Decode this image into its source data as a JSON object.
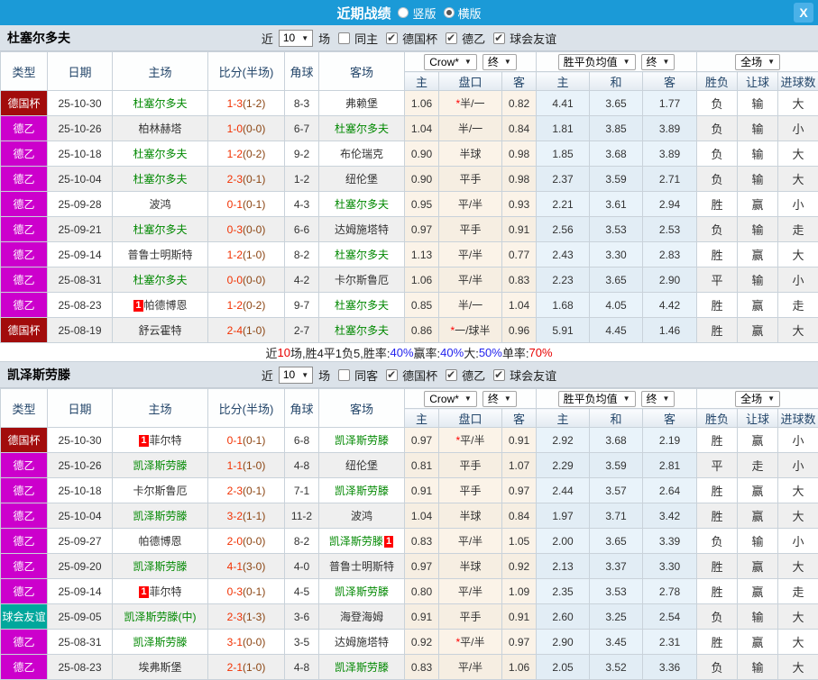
{
  "titlebar": {
    "title": "近期战绩",
    "radio_vertical": "竖版",
    "radio_horizontal": "横版",
    "close": "X"
  },
  "colors": {
    "titlebar_blue": "#1b9ad7",
    "cup_red": "#a20c0c",
    "league_magenta": "#cc00cc",
    "friendly_teal": "#00a79c",
    "focus_team_green": "#008800",
    "win_red": "#dd0000",
    "lose_green": "#008800",
    "draw_blue": "#1515dd"
  },
  "columns": {
    "type": "类型",
    "date": "日期",
    "home": "主场",
    "score": "比分(半场)",
    "corner": "角球",
    "away": "客场",
    "odds_home": "主",
    "handicap": "盘口",
    "odds_away": "客",
    "avg_home": "主",
    "avg_draw": "和",
    "avg_away": "客",
    "result": "胜负",
    "let_goal": "让球",
    "goals": "进球数"
  },
  "dropdowns": {
    "bookmaker": "Crow*",
    "final": "终",
    "avg": "胜平负均值",
    "fulltime": "全场"
  },
  "sections": [
    {
      "team": "杜塞尔多夫",
      "filter": {
        "near": "近",
        "count": "10",
        "games": "场",
        "same": "同主",
        "leagues": [
          "德国杯",
          "德乙",
          "球会友谊"
        ]
      },
      "rows": [
        {
          "type": "德国杯",
          "tc": "cup",
          "date": "25-10-30",
          "home": "杜塞尔多夫",
          "hg": 1,
          "score": "1-3",
          "half": "(1-2)",
          "corner": "8-3",
          "away": "弗赖堡",
          "o1": "1.06",
          "star": 1,
          "hcap": "半/一",
          "o2": "0.82",
          "a1": "4.41",
          "a2": "3.65",
          "a3": "1.77",
          "r1": "负",
          "c1": "g",
          "r2": "输",
          "c2": "g",
          "r3": "大",
          "c3": "r"
        },
        {
          "type": "德乙",
          "tc": "lg",
          "date": "25-10-26",
          "home": "柏林赫塔",
          "score": "1-0",
          "half": "(0-0)",
          "corner": "6-7",
          "away": "杜塞尔多夫",
          "ag": 1,
          "o1": "1.04",
          "hcap": "半/一",
          "o2": "0.84",
          "a1": "1.81",
          "a2": "3.85",
          "a3": "3.89",
          "r1": "负",
          "c1": "g",
          "r2": "输",
          "c2": "g",
          "r3": "小",
          "c3": "g"
        },
        {
          "type": "德乙",
          "tc": "lg",
          "date": "25-10-18",
          "home": "杜塞尔多夫",
          "hg": 1,
          "score": "1-2",
          "half": "(0-2)",
          "corner": "9-2",
          "away": "布伦瑞克",
          "o1": "0.90",
          "hcap": "半球",
          "o2": "0.98",
          "a1": "1.85",
          "a2": "3.68",
          "a3": "3.89",
          "r1": "负",
          "c1": "g",
          "r2": "输",
          "c2": "g",
          "r3": "大",
          "c3": "r"
        },
        {
          "type": "德乙",
          "tc": "lg",
          "date": "25-10-04",
          "home": "杜塞尔多夫",
          "hg": 1,
          "score": "2-3",
          "half": "(0-1)",
          "corner": "1-2",
          "away": "纽伦堡",
          "o1": "0.90",
          "hcap": "平手",
          "o2": "0.98",
          "a1": "2.37",
          "a2": "3.59",
          "a3": "2.71",
          "r1": "负",
          "c1": "g",
          "r2": "输",
          "c2": "g",
          "r3": "大",
          "c3": "r"
        },
        {
          "type": "德乙",
          "tc": "lg",
          "date": "25-09-28",
          "home": "波鸿",
          "score": "0-1",
          "half": "(0-1)",
          "corner": "4-3",
          "away": "杜塞尔多夫",
          "ag": 1,
          "o1": "0.95",
          "hcap": "平/半",
          "o2": "0.93",
          "a1": "2.21",
          "a2": "3.61",
          "a3": "2.94",
          "r1": "胜",
          "c1": "r",
          "r2": "赢",
          "c2": "r",
          "r3": "小",
          "c3": "g"
        },
        {
          "type": "德乙",
          "tc": "lg",
          "date": "25-09-21",
          "home": "杜塞尔多夫",
          "hg": 1,
          "score": "0-3",
          "half": "(0-0)",
          "corner": "6-6",
          "away": "达姆施塔特",
          "o1": "0.97",
          "hcap": "平手",
          "o2": "0.91",
          "a1": "2.56",
          "a2": "3.53",
          "a3": "2.53",
          "r1": "负",
          "c1": "g",
          "r2": "输",
          "c2": "g",
          "r3": "走",
          "c3": "b"
        },
        {
          "type": "德乙",
          "tc": "lg",
          "date": "25-09-14",
          "home": "普鲁士明斯特",
          "score": "1-2",
          "half": "(1-0)",
          "corner": "8-2",
          "away": "杜塞尔多夫",
          "ag": 1,
          "o1": "1.13",
          "hcap": "平/半",
          "o2": "0.77",
          "a1": "2.43",
          "a2": "3.30",
          "a3": "2.83",
          "r1": "胜",
          "c1": "r",
          "r2": "赢",
          "c2": "r",
          "r3": "大",
          "c3": "r"
        },
        {
          "type": "德乙",
          "tc": "lg",
          "date": "25-08-31",
          "home": "杜塞尔多夫",
          "hg": 1,
          "score": "0-0",
          "half": "(0-0)",
          "corner": "4-2",
          "away": "卡尔斯鲁厄",
          "o1": "1.06",
          "hcap": "平/半",
          "o2": "0.83",
          "a1": "2.23",
          "a2": "3.65",
          "a3": "2.90",
          "r1": "平",
          "c1": "b",
          "r2": "输",
          "c2": "g",
          "r3": "小",
          "c3": "g"
        },
        {
          "type": "德乙",
          "tc": "lg",
          "date": "25-08-23",
          "home": "帕德博恩",
          "hbadge": "1",
          "hbp": "before",
          "score": "1-2",
          "half": "(0-2)",
          "corner": "9-7",
          "away": "杜塞尔多夫",
          "ag": 1,
          "o1": "0.85",
          "hcap": "半/一",
          "o2": "1.04",
          "a1": "1.68",
          "a2": "4.05",
          "a3": "4.42",
          "r1": "胜",
          "c1": "r",
          "r2": "赢",
          "c2": "r",
          "r3": "走",
          "c3": "b"
        },
        {
          "type": "德国杯",
          "tc": "cup",
          "date": "25-08-19",
          "home": "舒云霍特",
          "score": "2-4",
          "half": "(1-0)",
          "corner": "2-7",
          "away": "杜塞尔多夫",
          "ag": 1,
          "o1": "0.86",
          "star": 1,
          "hcap": "一/球半",
          "o2": "0.96",
          "a1": "5.91",
          "a2": "4.45",
          "a3": "1.46",
          "r1": "胜",
          "c1": "r",
          "r2": "赢",
          "c2": "r",
          "r3": "大",
          "c3": "r"
        }
      ],
      "summary": [
        {
          "t": "近",
          "c": "k"
        },
        {
          "t": "10",
          "c": "r"
        },
        {
          "t": "场,胜4平1负5, ",
          "c": "k"
        },
        {
          "t": "胜率:",
          "c": "k"
        },
        {
          "t": "40%",
          "c": "b"
        },
        {
          "t": " 赢率:",
          "c": "k"
        },
        {
          "t": "40%",
          "c": "b"
        },
        {
          "t": " 大:",
          "c": "k"
        },
        {
          "t": "50%",
          "c": "b"
        },
        {
          "t": " 单率:",
          "c": "k"
        },
        {
          "t": "70%",
          "c": "r"
        }
      ]
    },
    {
      "team": "凯泽斯劳滕",
      "filter": {
        "near": "近",
        "count": "10",
        "games": "场",
        "same": "同客",
        "leagues": [
          "德国杯",
          "德乙",
          "球会友谊"
        ]
      },
      "rows": [
        {
          "type": "德国杯",
          "tc": "cup",
          "date": "25-10-30",
          "home": "菲尔特",
          "hbadge": "1",
          "hbp": "before",
          "score": "0-1",
          "half": "(0-1)",
          "corner": "6-8",
          "away": "凯泽斯劳滕",
          "ag": 1,
          "o1": "0.97",
          "star": 1,
          "hcap": "平/半",
          "o2": "0.91",
          "a1": "2.92",
          "a2": "3.68",
          "a3": "2.19",
          "r1": "胜",
          "c1": "r",
          "r2": "赢",
          "c2": "r",
          "r3": "小",
          "c3": "g"
        },
        {
          "type": "德乙",
          "tc": "lg",
          "date": "25-10-26",
          "home": "凯泽斯劳滕",
          "hg": 1,
          "score": "1-1",
          "half": "(1-0)",
          "corner": "4-8",
          "away": "纽伦堡",
          "o1": "0.81",
          "hcap": "平手",
          "o2": "1.07",
          "a1": "2.29",
          "a2": "3.59",
          "a3": "2.81",
          "r1": "平",
          "c1": "b",
          "r2": "走",
          "c2": "b",
          "r3": "小",
          "c3": "g"
        },
        {
          "type": "德乙",
          "tc": "lg",
          "date": "25-10-18",
          "home": "卡尔斯鲁厄",
          "score": "2-3",
          "half": "(0-1)",
          "corner": "7-1",
          "away": "凯泽斯劳滕",
          "ag": 1,
          "o1": "0.91",
          "hcap": "平手",
          "o2": "0.97",
          "a1": "2.44",
          "a2": "3.57",
          "a3": "2.64",
          "r1": "胜",
          "c1": "r",
          "r2": "赢",
          "c2": "r",
          "r3": "大",
          "c3": "r"
        },
        {
          "type": "德乙",
          "tc": "lg",
          "date": "25-10-04",
          "home": "凯泽斯劳滕",
          "hg": 1,
          "score": "3-2",
          "half": "(1-1)",
          "corner": "11-2",
          "away": "波鸿",
          "o1": "1.04",
          "hcap": "半球",
          "o2": "0.84",
          "a1": "1.97",
          "a2": "3.71",
          "a3": "3.42",
          "r1": "胜",
          "c1": "r",
          "r2": "赢",
          "c2": "r",
          "r3": "大",
          "c3": "r"
        },
        {
          "type": "德乙",
          "tc": "lg",
          "date": "25-09-27",
          "home": "帕德博恩",
          "score": "2-0",
          "half": "(0-0)",
          "corner": "8-2",
          "away": "凯泽斯劳滕",
          "ag": 1,
          "abadge": "1",
          "abp": "after",
          "o1": "0.83",
          "hcap": "平/半",
          "o2": "1.05",
          "a1": "2.00",
          "a2": "3.65",
          "a3": "3.39",
          "r1": "负",
          "c1": "g",
          "r2": "输",
          "c2": "g",
          "r3": "小",
          "c3": "g"
        },
        {
          "type": "德乙",
          "tc": "lg",
          "date": "25-09-20",
          "home": "凯泽斯劳滕",
          "hg": 1,
          "score": "4-1",
          "half": "(3-0)",
          "corner": "4-0",
          "away": "普鲁士明斯特",
          "o1": "0.97",
          "hcap": "半球",
          "o2": "0.92",
          "a1": "2.13",
          "a2": "3.37",
          "a3": "3.30",
          "r1": "胜",
          "c1": "r",
          "r2": "赢",
          "c2": "r",
          "r3": "大",
          "c3": "r"
        },
        {
          "type": "德乙",
          "tc": "lg",
          "date": "25-09-14",
          "home": "菲尔特",
          "hbadge": "1",
          "hbp": "before",
          "score": "0-3",
          "half": "(0-1)",
          "corner": "4-5",
          "away": "凯泽斯劳滕",
          "ag": 1,
          "o1": "0.80",
          "hcap": "平/半",
          "o2": "1.09",
          "a1": "2.35",
          "a2": "3.53",
          "a3": "2.78",
          "r1": "胜",
          "c1": "r",
          "r2": "赢",
          "c2": "r",
          "r3": "走",
          "c3": "b"
        },
        {
          "type": "球会友谊",
          "tc": "fr",
          "date": "25-09-05",
          "home": "凯泽斯劳滕(中)",
          "hg": 1,
          "score": "2-3",
          "half": "(1-3)",
          "corner": "3-6",
          "away": "海登海姆",
          "o1": "0.91",
          "hcap": "平手",
          "o2": "0.91",
          "a1": "2.60",
          "a2": "3.25",
          "a3": "2.54",
          "r1": "负",
          "c1": "g",
          "r2": "输",
          "c2": "g",
          "r3": "大",
          "c3": "r"
        },
        {
          "type": "德乙",
          "tc": "lg",
          "date": "25-08-31",
          "home": "凯泽斯劳滕",
          "hg": 1,
          "score": "3-1",
          "half": "(0-0)",
          "corner": "3-5",
          "away": "达姆施塔特",
          "o1": "0.92",
          "star": 1,
          "hcap": "平/半",
          "o2": "0.97",
          "a1": "2.90",
          "a2": "3.45",
          "a3": "2.31",
          "r1": "胜",
          "c1": "r",
          "r2": "赢",
          "c2": "r",
          "r3": "大",
          "c3": "r"
        },
        {
          "type": "德乙",
          "tc": "lg",
          "date": "25-08-23",
          "home": "埃弗斯堡",
          "score": "2-1",
          "half": "(1-0)",
          "corner": "4-8",
          "away": "凯泽斯劳滕",
          "ag": 1,
          "o1": "0.83",
          "hcap": "平/半",
          "o2": "1.06",
          "a1": "2.05",
          "a2": "3.52",
          "a3": "3.36",
          "r1": "负",
          "c1": "g",
          "r2": "输",
          "c2": "g",
          "r3": "大",
          "c3": "r"
        }
      ]
    }
  ]
}
